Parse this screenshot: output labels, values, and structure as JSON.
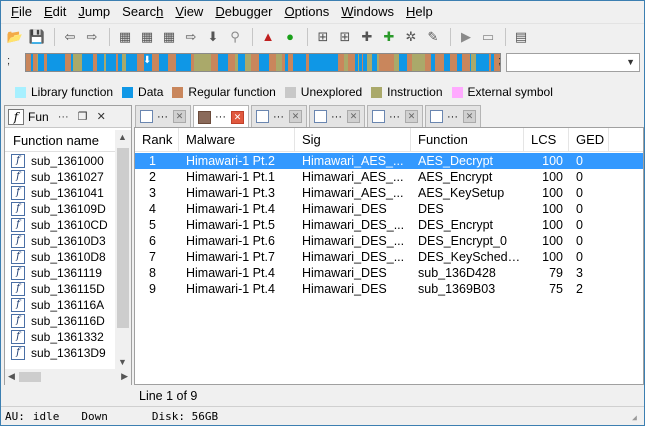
{
  "menu": [
    "File",
    "Edit",
    "Jump",
    "Search",
    "View",
    "Debugger",
    "Options",
    "Windows",
    "Help"
  ],
  "menu_underline": [
    "F",
    "E",
    "J",
    "h",
    "V",
    "D",
    "O",
    "W",
    "H"
  ],
  "legend": [
    {
      "label": "Library function",
      "color": "#a7f0ff"
    },
    {
      "label": "Data",
      "color": "#0f97e6"
    },
    {
      "label": "Regular function",
      "color": "#c9865c"
    },
    {
      "label": "Unexplored",
      "color": "#c8c8c8"
    },
    {
      "label": "Instruction",
      "color": "#aaa96a"
    },
    {
      "label": "External symbol",
      "color": "#ffaaff"
    }
  ],
  "functions_panel": {
    "title": "Fun",
    "column_header": "Function name",
    "items": [
      "sub_1361000",
      "sub_1361027",
      "sub_1361041",
      "sub_136109D",
      "sub_13610CD",
      "sub_13610D3",
      "sub_13610D8",
      "sub_1361119",
      "sub_136115D",
      "sub_136116A",
      "sub_136116D",
      "sub_1361332",
      "sub_13613D9"
    ]
  },
  "table": {
    "columns": [
      "Rank",
      "Malware",
      "Sig",
      "Function",
      "LCS",
      "GED"
    ],
    "rows": [
      [
        "1",
        "Himawari-1 Pt.2",
        "Himawari_AES_...",
        "AES_Decrypt",
        "100",
        "0"
      ],
      [
        "2",
        "Himawari-1 Pt.1",
        "Himawari_AES_...",
        "AES_Encrypt",
        "100",
        "0"
      ],
      [
        "3",
        "Himawari-1 Pt.3",
        "Himawari_AES_...",
        "AES_KeySetup",
        "100",
        "0"
      ],
      [
        "4",
        "Himawari-1 Pt.4",
        "Himawari_DES",
        "DES",
        "100",
        "0"
      ],
      [
        "5",
        "Himawari-1 Pt.5",
        "Himawari_DES_...",
        "DES_Encrypt",
        "100",
        "0"
      ],
      [
        "6",
        "Himawari-1 Pt.6",
        "Himawari_DES_...",
        "DES_Encrypt_0",
        "100",
        "0"
      ],
      [
        "7",
        "Himawari-1 Pt.7",
        "Himawari_DES_...",
        "DES_KeySchedule",
        "100",
        "0"
      ],
      [
        "8",
        "Himawari-1 Pt.4",
        "Himawari_DES",
        "sub_136D428",
        "79",
        "3"
      ],
      [
        "9",
        "Himawari-1 Pt.4",
        "Himawari_DES",
        "sub_1369B03",
        "75",
        "2"
      ]
    ],
    "selected_row": 0
  },
  "line_status": "Line 1 of 9",
  "status": {
    "au": "AU:",
    "au_value": "idle",
    "direction": "Down",
    "disk": "Disk: 56GB"
  }
}
